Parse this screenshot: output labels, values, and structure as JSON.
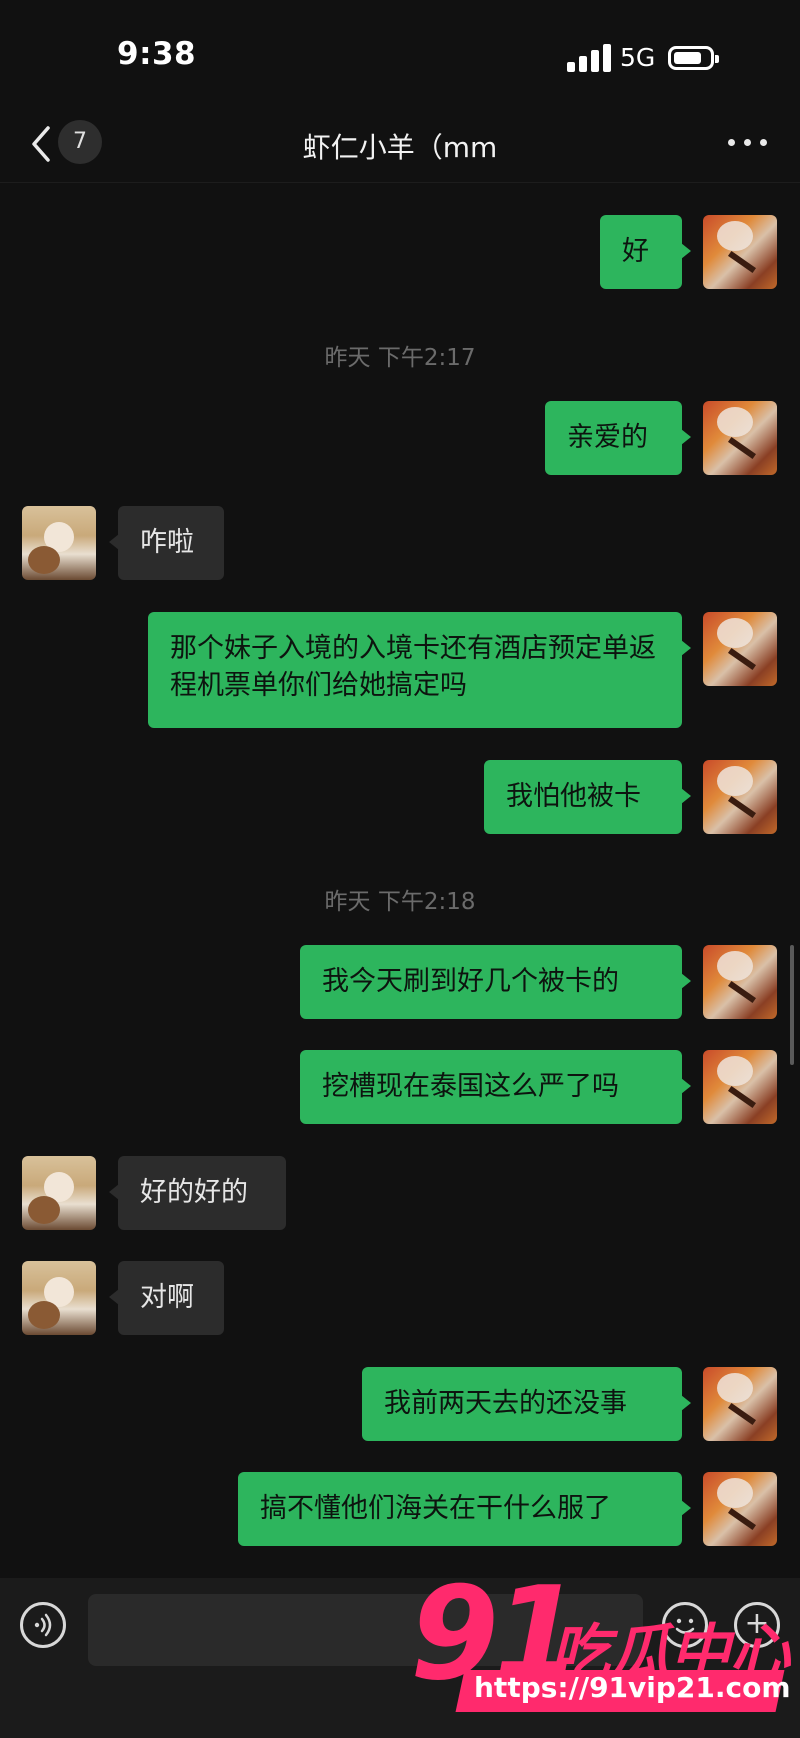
{
  "status": {
    "time": "9:38",
    "network": "5G"
  },
  "header": {
    "unread_count": "7",
    "title": "虾仁小羊（mm"
  },
  "messages": [
    {
      "side": "out",
      "text": "好"
    },
    {
      "timestamp": "昨天 下午2:17"
    },
    {
      "side": "out",
      "text": "亲爱的"
    },
    {
      "side": "in",
      "text": "咋啦"
    },
    {
      "side": "out",
      "text": "那个妹子入境的入境卡还有酒店预定单返程机票单你们给她搞定吗"
    },
    {
      "side": "out",
      "text": "我怕他被卡"
    },
    {
      "timestamp": "昨天 下午2:18"
    },
    {
      "side": "out",
      "text": "我今天刷到好几个被卡的"
    },
    {
      "side": "out",
      "text": "挖槽现在泰国这么严了吗"
    },
    {
      "side": "in",
      "text": "好的好的"
    },
    {
      "side": "in",
      "text": "对啊"
    },
    {
      "side": "out",
      "text": "我前两天去的还没事"
    },
    {
      "side": "out",
      "text": "搞不懂他们海关在干什么服了"
    }
  ],
  "watermark": {
    "number": "91",
    "brand": "吃瓜中心",
    "url": "https://91vip21.com"
  },
  "icons": [
    "back-chevron-icon",
    "more-dots-icon",
    "voice-icon",
    "emoji-icon",
    "plus-icon",
    "signal-icon",
    "battery-icon"
  ]
}
